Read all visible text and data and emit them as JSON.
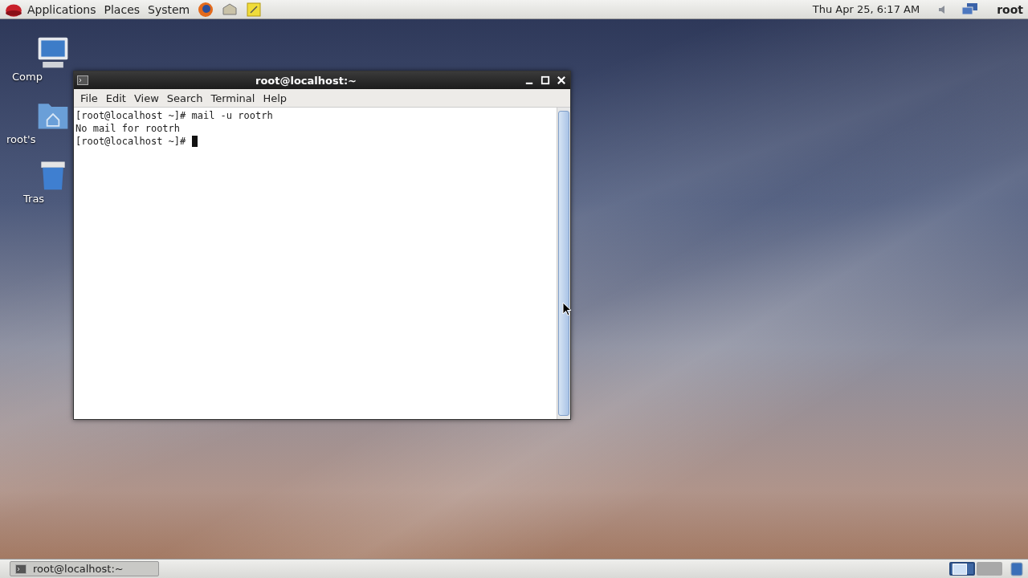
{
  "top_panel": {
    "menus": [
      "Applications",
      "Places",
      "System"
    ],
    "clock": "Thu Apr 25,  6:17 AM",
    "user": "root"
  },
  "desktop_icons": [
    {
      "kind": "computer",
      "label": "Comp"
    },
    {
      "kind": "home",
      "label": "root's"
    },
    {
      "kind": "trash",
      "label": "Tras"
    }
  ],
  "window": {
    "title": "root@localhost:~",
    "menu": [
      "File",
      "Edit",
      "View",
      "Search",
      "Terminal",
      "Help"
    ],
    "lines": [
      "[root@localhost ~]# mail -u rootrh",
      "No mail for rootrh",
      "[root@localhost ~]# "
    ]
  },
  "bottom_panel": {
    "tasks": [
      {
        "label": "root@localhost:~",
        "selected": false
      }
    ],
    "workspaces": [
      {
        "selected": true
      },
      {
        "selected": false
      }
    ]
  }
}
